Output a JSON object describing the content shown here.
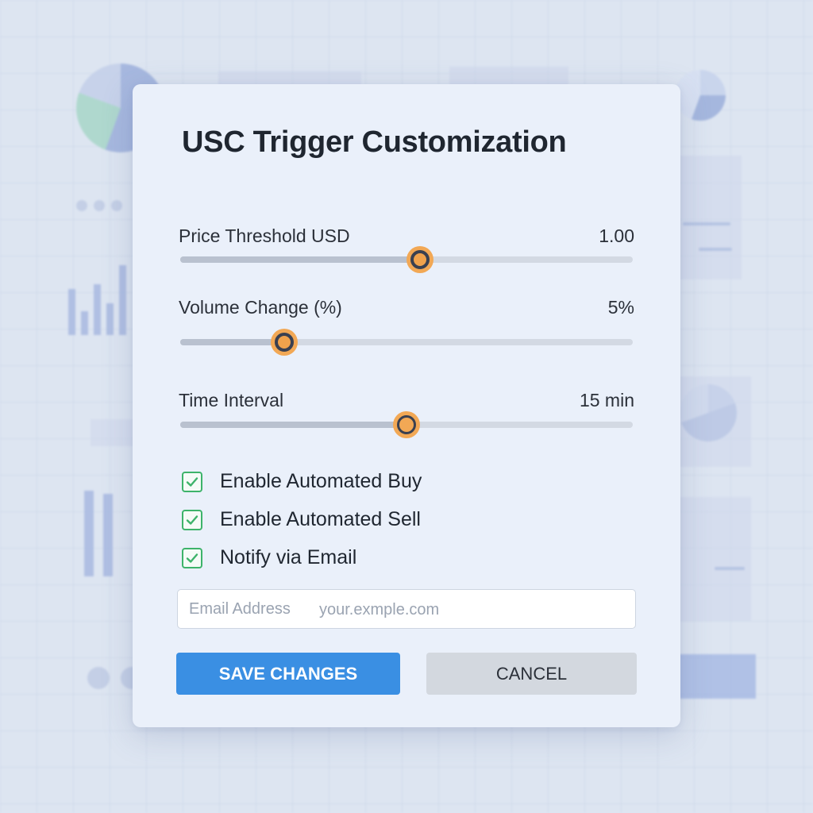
{
  "dialog": {
    "title": "USC Trigger Customization"
  },
  "sliders": [
    {
      "label": "Price Threshold USD",
      "value_text": "1.00",
      "level": 0.53
    },
    {
      "label": "Volume Change (%)",
      "value_text": "5%",
      "level": 0.23
    },
    {
      "label": "Time Interval",
      "value_text": "15 min",
      "level": 0.5
    }
  ],
  "checkboxes": [
    {
      "label": "Enable Automated Buy",
      "checked": true
    },
    {
      "label": "Enable Automated Sell",
      "checked": true
    },
    {
      "label": "Notify via Email",
      "checked": true
    }
  ],
  "email": {
    "label": "Email Address",
    "placeholder": "your.exmple.com"
  },
  "buttons": {
    "save": "SAVE CHANGES",
    "cancel": "CANCEL"
  },
  "colors": {
    "accent": "#3a8fe3",
    "slider_thumb": "#f2a855",
    "check": "#3db36a"
  },
  "icons": [
    "check-icon"
  ]
}
